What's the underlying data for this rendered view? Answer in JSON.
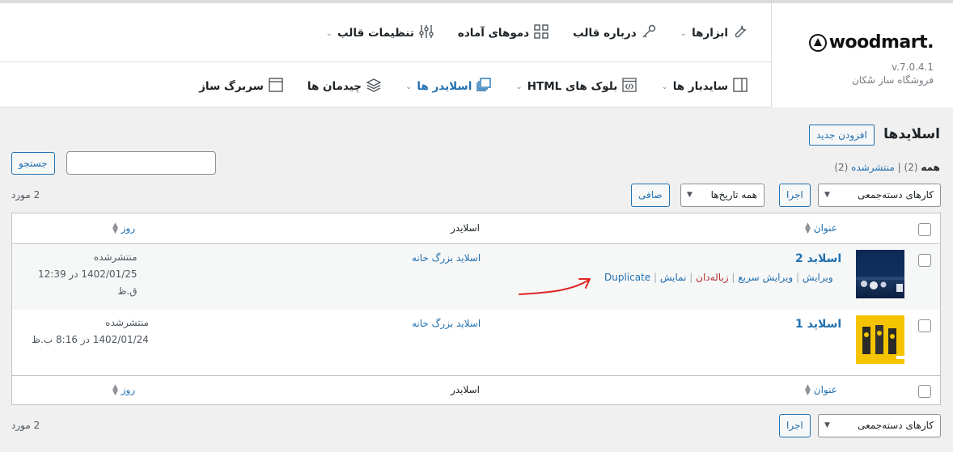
{
  "brand": {
    "logo_text": "woodmart.",
    "version": "v.7.0.4.1",
    "shop_name": "فروشگاه ساز سُکان"
  },
  "menu_top": [
    {
      "label": "تنظیمات قالب",
      "icon": "sliders-icon",
      "dropdown": true
    },
    {
      "label": "دموهای آماده",
      "icon": "grid-icon",
      "dropdown": false
    },
    {
      "label": "درباره قالب",
      "icon": "key-icon",
      "dropdown": false
    },
    {
      "label": "ابزارها",
      "icon": "wrench-icon",
      "dropdown": true
    }
  ],
  "menu_bottom": [
    {
      "label": "سربرگ ساز",
      "icon": "layout-icon",
      "dropdown": false
    },
    {
      "label": "چیدمان ها",
      "icon": "layers-icon",
      "dropdown": false
    },
    {
      "label": "اسلایدر ها",
      "icon": "slides-icon",
      "dropdown": true,
      "active": true
    },
    {
      "label": "بلوک های HTML",
      "icon": "code-block-icon",
      "dropdown": true
    },
    {
      "label": "سایدبار ها",
      "icon": "sidebar-icon",
      "dropdown": true
    }
  ],
  "page": {
    "title": "اسلایدها",
    "add_new": "افزودن جدید",
    "filter_all_label": "همه",
    "filter_all_count": "(2)",
    "filter_sep": "|",
    "filter_published_label": "منتشرشده",
    "filter_published_count": "(2)",
    "search_button": "جستجو",
    "search_value": ""
  },
  "toolbar_top": {
    "bulk_actions": "کارهای دسته‌جمعی",
    "apply": "اجرا",
    "all_dates": "همه تاریخ‌ها",
    "filter": "صافی",
    "item_count": "2 مورد"
  },
  "toolbar_bottom": {
    "bulk_actions": "کارهای دسته‌جمعی",
    "apply": "اجرا",
    "item_count": "2 مورد"
  },
  "table": {
    "columns": {
      "title": "عنوان",
      "slider": "اسلایدر",
      "date": "روز"
    },
    "rows": [
      {
        "title": "اسلاید 2",
        "actions": {
          "edit": "ویرایش",
          "quick_edit": "ویرایش سریع",
          "trash": "زباله‌دان",
          "view": "نمایش",
          "duplicate": "Duplicate",
          "sep": "|"
        },
        "slider": "اسلاید بزرگ خانه",
        "status": "منتشرشده",
        "date": "1402/01/25 در 12:39",
        "period": "ق.ظ"
      },
      {
        "title": "اسلاید 1",
        "slider": "اسلاید بزرگ خانه",
        "status": "منتشرشده",
        "date": "1402/01/24 در 8:16 ب.ظ"
      }
    ]
  },
  "colors": {
    "accent": "#2271b1",
    "trash": "#b32d2e",
    "annotation_arrow": "#e02424",
    "background": "#f0f0f1"
  }
}
